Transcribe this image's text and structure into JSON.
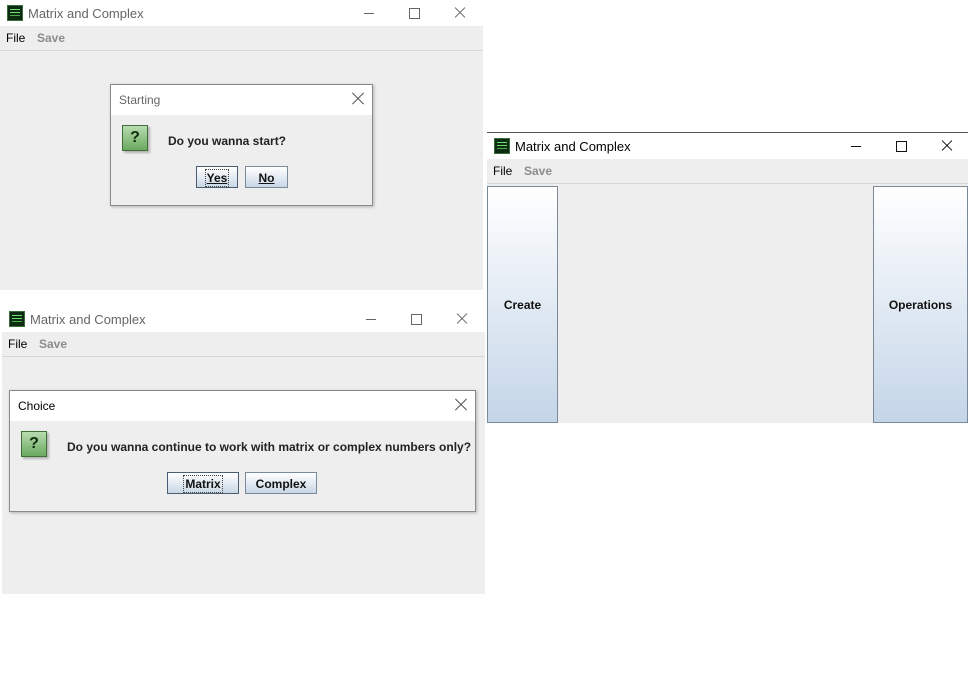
{
  "window_top_left": {
    "title": "Matrix and Complex",
    "menu": {
      "file": "File",
      "save": "Save"
    },
    "dialog": {
      "title": "Starting",
      "icon": "question-icon",
      "message": "Do you wanna start?",
      "yes_label": "Yes",
      "no_label": "No"
    }
  },
  "window_bottom_left": {
    "title": "Matrix and Complex",
    "menu": {
      "file": "File",
      "save": "Save"
    },
    "dialog": {
      "title": "Choice",
      "icon": "question-icon",
      "message": "Do you wanna continue to work with matrix or complex numbers only?",
      "matrix_label": "Matrix",
      "complex_label": "Complex"
    }
  },
  "window_right": {
    "title": "Matrix and Complex",
    "menu": {
      "file": "File",
      "save": "Save"
    },
    "create_label": "Create",
    "operations_label": "Operations"
  },
  "colors": {
    "window_bg": "#eeeeee",
    "button_gradient_top": "#ffffff",
    "button_gradient_bottom": "#c4d5e8",
    "question_icon_green": "#6aa95f"
  }
}
